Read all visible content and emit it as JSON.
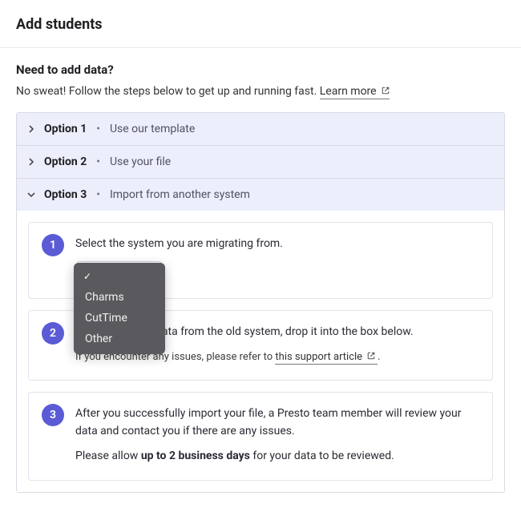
{
  "page": {
    "title": "Add students"
  },
  "section": {
    "heading": "Need to add data?",
    "intro": "No sweat! Follow the steps below to get up and running fast. ",
    "learn_more": "Learn more"
  },
  "accordion": {
    "option1": {
      "label": "Option 1",
      "desc": "Use our template"
    },
    "option2": {
      "label": "Option 2",
      "desc": "Use your file"
    },
    "option3": {
      "label": "Option 3",
      "desc": "Import from another system"
    }
  },
  "steps": {
    "step1": {
      "num": "1",
      "text": "Select the system you are migrating from."
    },
    "step2": {
      "num": "2",
      "text_suffix": "e exported your data from the old system, drop it into the box below.",
      "sub_prefix": "If you encounter any issues, please refer to ",
      "sub_link": "this support article",
      "sub_suffix": "."
    },
    "step3": {
      "num": "3",
      "text": "After you successfully import your file, a Presto team member will review your data and contact you if there are any issues.",
      "allow_prefix": "Please allow ",
      "allow_bold": "up to 2 business days",
      "allow_suffix": " for your data to be reviewed."
    }
  },
  "dropdown": {
    "options": {
      "o0": "Charms",
      "o1": "CutTime",
      "o2": "Other"
    },
    "check": "✓"
  },
  "bullet": "•"
}
